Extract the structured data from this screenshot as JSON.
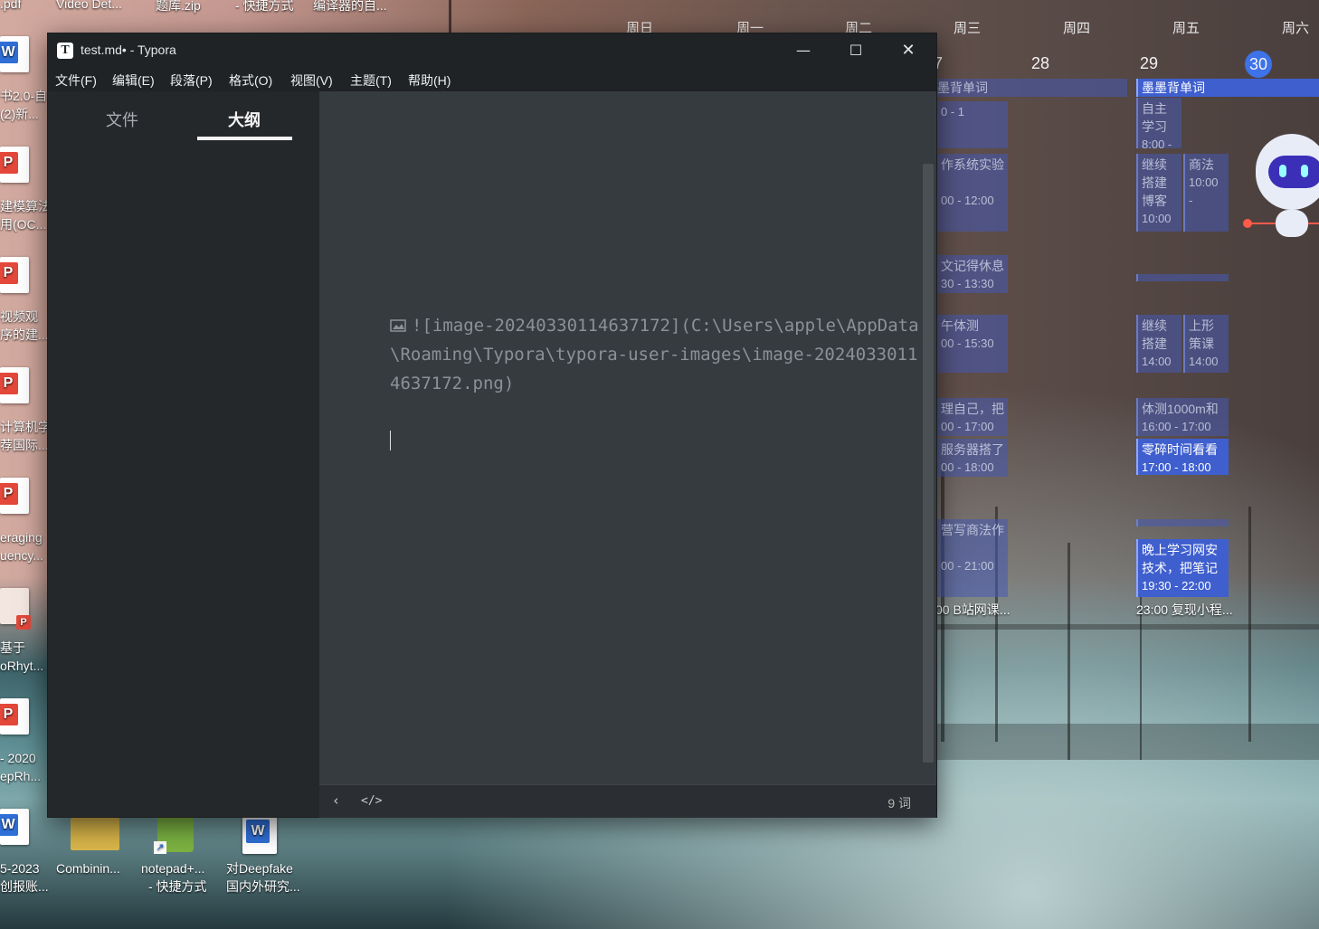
{
  "desktop": {
    "top_icons": [
      ".pdf",
      "Video Det...",
      "题库.zip",
      "- 快捷方式",
      "编译器的自..."
    ],
    "left_icons": [
      {
        "lines": [
          "书2.0-自",
          "(2)新..."
        ],
        "type": "W",
        "color": "#2f6fd6"
      },
      {
        "lines": [
          "建模算法",
          "用(OC..."
        ],
        "type": "P",
        "color": "#e3483a"
      },
      {
        "lines": [
          "视频观",
          "序的建..."
        ],
        "type": "P",
        "color": "#e3483a"
      },
      {
        "lines": [
          "计算机学",
          "荐国际..."
        ],
        "type": "P",
        "color": "#e3483a"
      },
      {
        "lines": [
          "eraging",
          "uency..."
        ],
        "type": "P",
        "color": "#e3483a"
      },
      {
        "lines": [
          "基于",
          "oRhyt..."
        ],
        "type": "P",
        "color": "#e3483a"
      },
      {
        "lines": [
          "- 2020",
          "epRh..."
        ],
        "type": "P",
        "color": "#e3483a"
      },
      {
        "lines": [
          "5-2023",
          "创报账..."
        ],
        "type": "W",
        "color": "#2f6fd6"
      }
    ],
    "bottom_icons": [
      {
        "lines": [
          "Combinin..."
        ],
        "kind": "zip-icon"
      },
      {
        "lines": [
          "notepad+...",
          "- 快捷方式"
        ],
        "kind": "notepad-icon"
      },
      {
        "lines": [
          "对Deepfake",
          "国内外研究..."
        ],
        "kind": "word-icon"
      }
    ]
  },
  "calendar": {
    "day_names": [
      "周日",
      "周一",
      "周二",
      "周三",
      "周四",
      "周五",
      "周六"
    ],
    "day_numbers": [
      "7",
      "28",
      "29",
      "30"
    ],
    "events_col_wed": [
      {
        "title": "墨背单词",
        "time": ""
      },
      {
        "title": "",
        "time": "0 - 1"
      },
      {
        "title": "作系统实验",
        "time": "00 - 12:00"
      },
      {
        "title": "文记得休息",
        "time": "30 - 13:30"
      },
      {
        "title": "午体测",
        "time": "00 - 15:30"
      },
      {
        "title": "理自己，把",
        "time": "00 - 17:00"
      },
      {
        "title": "服务器搭了",
        "time": "00 - 18:00"
      },
      {
        "title": "营写商法作",
        "time": "00 - 21:00"
      }
    ],
    "events_col_fri": [
      {
        "title": "墨墨背单词",
        "time": ""
      },
      {
        "title": "自主学习",
        "time": "8:00 - 1"
      },
      {
        "title": "继续搭建博客",
        "time": "10:00 -"
      },
      {
        "title": "商法",
        "time": "10:00 -"
      },
      {
        "title": "继续搭建",
        "time": "14:00 -"
      },
      {
        "title": "上形策课",
        "time": "14:00 -"
      },
      {
        "title": "体测1000m和",
        "time": "16:00 - 17:00"
      },
      {
        "title": "零碎时间看看",
        "time": "17:00 - 18:00"
      },
      {
        "title": "晚上学习网安技术，把笔记",
        "time": "19:30 - 22:00"
      }
    ],
    "overflow_wed": "00 B站网课...",
    "overflow_fri": "23:00 复现小程..."
  },
  "window": {
    "title": "test.md• - Typora",
    "menus": [
      "文件(F)",
      "编辑(E)",
      "段落(P)",
      "格式(O)",
      "视图(V)",
      "主题(T)",
      "帮助(H)"
    ],
    "sidebar_tabs": [
      {
        "label": "文件",
        "active": false
      },
      {
        "label": "大纲",
        "active": true
      }
    ],
    "editor_text": "![image-20240330114637172](C:\\Users\\apple\\AppData\\Roaming\\Typora\\typora-user-images\\image-20240330114637172.png)",
    "word_count": "9 词"
  }
}
